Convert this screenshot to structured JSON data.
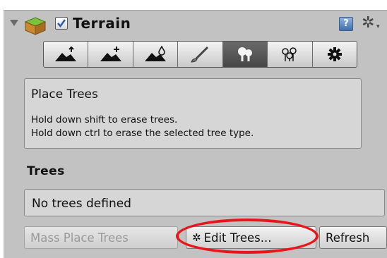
{
  "component": {
    "title": "Terrain",
    "enabled": true,
    "help_icon_text": "?",
    "settings_icon": "gear-icon"
  },
  "toolbar": {
    "tools": [
      {
        "name": "raise-lower-terrain",
        "icon": "mountain-up-arrow-icon",
        "active": false
      },
      {
        "name": "paint-height",
        "icon": "mountain-plus-icon",
        "active": false
      },
      {
        "name": "smooth-height",
        "icon": "mountain-drop-icon",
        "active": false
      },
      {
        "name": "paint-texture",
        "icon": "paintbrush-icon",
        "active": false
      },
      {
        "name": "place-trees",
        "icon": "trees-icon",
        "active": true
      },
      {
        "name": "paint-details",
        "icon": "flowers-icon",
        "active": false
      },
      {
        "name": "terrain-settings",
        "icon": "cog-icon",
        "active": false
      }
    ]
  },
  "info": {
    "heading": "Place Trees",
    "line1": "Hold down shift to erase trees.",
    "line2": "Hold down ctrl to erase the selected tree type."
  },
  "trees": {
    "section_label": "Trees",
    "empty_text": "No trees defined"
  },
  "buttons": {
    "mass_place": "Mass Place Trees",
    "edit_trees": "Edit Trees...",
    "refresh": "Refresh"
  },
  "colors": {
    "panel": "#c2c2c2",
    "annotation": "#e8161b",
    "active_tool": "#555555"
  }
}
